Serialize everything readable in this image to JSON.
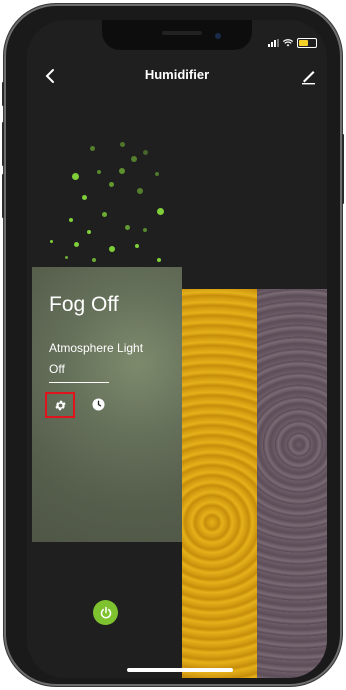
{
  "header": {
    "title": "Humidifier"
  },
  "panel": {
    "fog_status": "Fog Off",
    "atmosphere_label": "Atmosphere Light",
    "atmosphere_state": "Off"
  },
  "icons": {
    "back": "chevron-left-icon",
    "edit": "pencil-icon",
    "settings": "gear-icon",
    "timer": "clock-icon",
    "power": "power-icon"
  },
  "colors": {
    "accent_green": "#7ec22f",
    "highlight_red": "#e0141d",
    "screen_bg": "#1f1f1f"
  }
}
